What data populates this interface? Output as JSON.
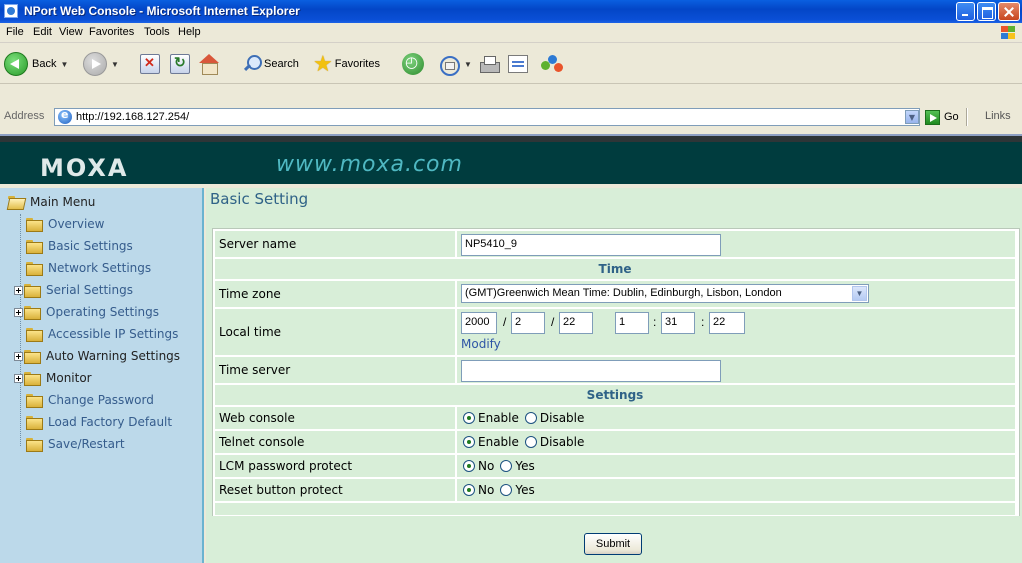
{
  "window": {
    "title": "NPort Web Console - Microsoft Internet Explorer"
  },
  "menubar": [
    "File",
    "Edit",
    "View",
    "Favorites",
    "Tools",
    "Help"
  ],
  "toolbar": {
    "back": "Back",
    "search": "Search",
    "favorites": "Favorites"
  },
  "address": {
    "label": "Address",
    "url": "http://192.168.127.254/",
    "go": "Go",
    "links": "Links"
  },
  "banner": {
    "logo": "MOXA",
    "url": "www.moxa.com"
  },
  "nav": {
    "root": "Main Menu",
    "items": [
      {
        "label": "Overview",
        "expandable": false
      },
      {
        "label": "Basic Settings",
        "expandable": false
      },
      {
        "label": "Network Settings",
        "expandable": false
      },
      {
        "label": "Serial Settings",
        "expandable": true
      },
      {
        "label": "Operating Settings",
        "expandable": true
      },
      {
        "label": "Accessible IP Settings",
        "expandable": false
      },
      {
        "label": "Auto Warning Settings",
        "expandable": true
      },
      {
        "label": "Monitor",
        "expandable": true
      },
      {
        "label": "Change Password",
        "expandable": false
      },
      {
        "label": "Load Factory Default",
        "expandable": false
      },
      {
        "label": "Save/Restart",
        "expandable": false
      }
    ]
  },
  "main": {
    "title": "Basic Setting",
    "server_name": {
      "label": "Server name",
      "value": "NP5410_9"
    },
    "time_section": "Time",
    "time_zone": {
      "label": "Time zone",
      "value": "(GMT)Greenwich Mean Time: Dublin, Edinburgh, Lisbon, London"
    },
    "local_time": {
      "label": "Local time",
      "year": "2000",
      "month": "2",
      "day": "22",
      "hour": "1",
      "minute": "31",
      "second": "22",
      "modify": "Modify"
    },
    "time_server": {
      "label": "Time server",
      "value": ""
    },
    "settings_section": "Settings",
    "web_console": {
      "label": "Web console",
      "opt1": "Enable",
      "opt2": "Disable"
    },
    "telnet_console": {
      "label": "Telnet console",
      "opt1": "Enable",
      "opt2": "Disable"
    },
    "lcm_password": {
      "label": "LCM password protect",
      "opt1": "No",
      "opt2": "Yes"
    },
    "reset_button": {
      "label": "Reset button protect",
      "opt1": "No",
      "opt2": "Yes"
    },
    "submit": "Submit"
  }
}
